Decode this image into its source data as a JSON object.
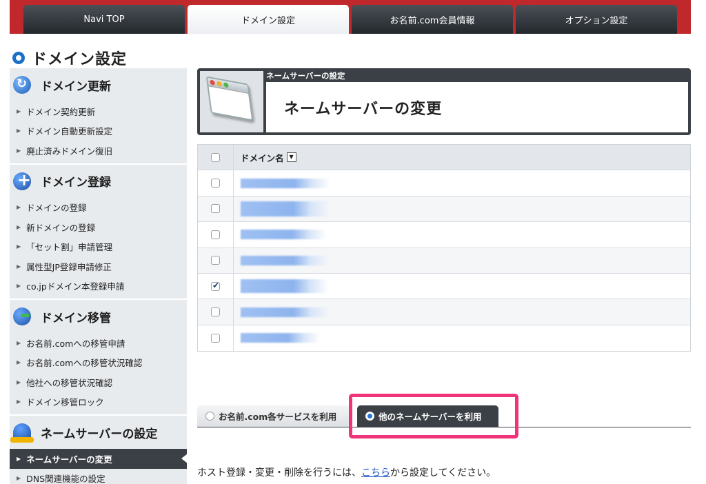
{
  "top_nav": {
    "tabs": [
      {
        "label": "Navi TOP"
      },
      {
        "label": "ドメイン設定"
      },
      {
        "label": "お名前.com会員情報"
      },
      {
        "label": "オプション設定"
      }
    ],
    "active_index": 1,
    "bar_color": "#c0282b"
  },
  "page": {
    "title": "ドメイン設定"
  },
  "sidebar": {
    "sections": [
      {
        "title": "ドメイン更新",
        "icon": "renew-globe-icon",
        "items": [
          "ドメイン契約更新",
          "ドメイン自動更新設定",
          "廃止済みドメイン復旧"
        ]
      },
      {
        "title": "ドメイン登録",
        "icon": "add-globe-icon",
        "items": [
          "ドメインの登録",
          "新ドメインの登録",
          "「セット割」申請管理",
          "属性型JP登録申請修正",
          "co.jpドメイン本登録申請"
        ]
      },
      {
        "title": "ドメイン移管",
        "icon": "transfer-globe-icon",
        "items": [
          "お名前.comへの移管申請",
          "お名前.comへの移管状況確認",
          "他社への移管状況確認",
          "ドメイン移管ロック"
        ]
      },
      {
        "title": "ネームサーバーの設定",
        "icon": "nameserver-icon",
        "items": [
          "ネームサーバーの変更",
          "DNS関連機能の設定"
        ]
      }
    ],
    "active_item": "ネームサーバーの変更"
  },
  "header_box": {
    "label": "ネームサーバーの設定",
    "title": "ネームサーバーの変更",
    "icon": "browser-window-icon"
  },
  "domain_table": {
    "header": {
      "column_label": "ドメイン名",
      "sort_icon": "▼"
    },
    "rows": [
      {
        "checked": false
      },
      {
        "checked": false
      },
      {
        "checked": false
      },
      {
        "checked": false
      },
      {
        "checked": true
      },
      {
        "checked": false
      },
      {
        "checked": false
      }
    ]
  },
  "nameserver_options": {
    "tabs": [
      {
        "label": "お名前.com各サービスを利用",
        "selected": false
      },
      {
        "label": "他のネームサーバーを利用",
        "selected": true
      }
    ],
    "highlight_color": "#f0347a"
  },
  "note": {
    "before": "ホスト登録・変更・削除を行うには、",
    "link": "こちら",
    "after": "から設定してください。"
  }
}
